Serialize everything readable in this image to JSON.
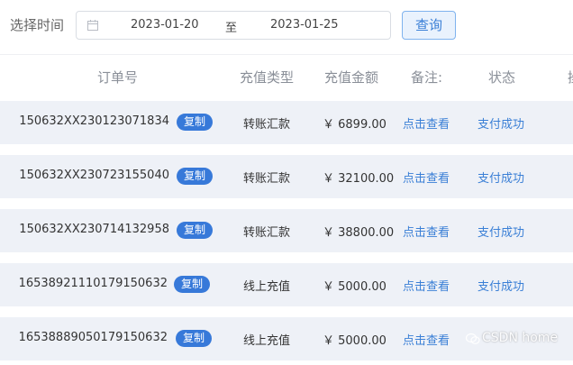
{
  "filter": {
    "label": "选择时间",
    "start_date": "2023-01-20",
    "separator": "至",
    "end_date": "2023-01-25",
    "query_button": "查询"
  },
  "table": {
    "headers": {
      "order": "订单号",
      "type": "充值类型",
      "amount": "充值金额",
      "note": "备注:",
      "status": "状态",
      "extra": "操"
    },
    "copy_label": "复制",
    "rows": [
      {
        "order": "150632XX230123071834",
        "type": "转账汇款",
        "amount": "￥ 6899.00",
        "note": "点击查看",
        "status": "支付成功"
      },
      {
        "order": "150632XX230723155040",
        "type": "转账汇款",
        "amount": "￥ 32100.00",
        "note": "点击查看",
        "status": "支付成功"
      },
      {
        "order": "150632XX230714132958",
        "type": "转账汇款",
        "amount": "￥ 38800.00",
        "note": "点击查看",
        "status": "支付成功"
      },
      {
        "order": "16538921110179150632",
        "type": "线上充值",
        "amount": "￥ 5000.00",
        "note": "点击查看",
        "status": "支付成功"
      },
      {
        "order": "16538889050179150632",
        "type": "线上充值",
        "amount": "￥ 5000.00",
        "note": "点击查看",
        "status": "支付成功"
      }
    ]
  },
  "watermark": {
    "text": "CSDN home"
  },
  "colors": {
    "accent": "#3a7fd6",
    "badge": "#3779d9",
    "row_bg": "#eef1f7"
  }
}
